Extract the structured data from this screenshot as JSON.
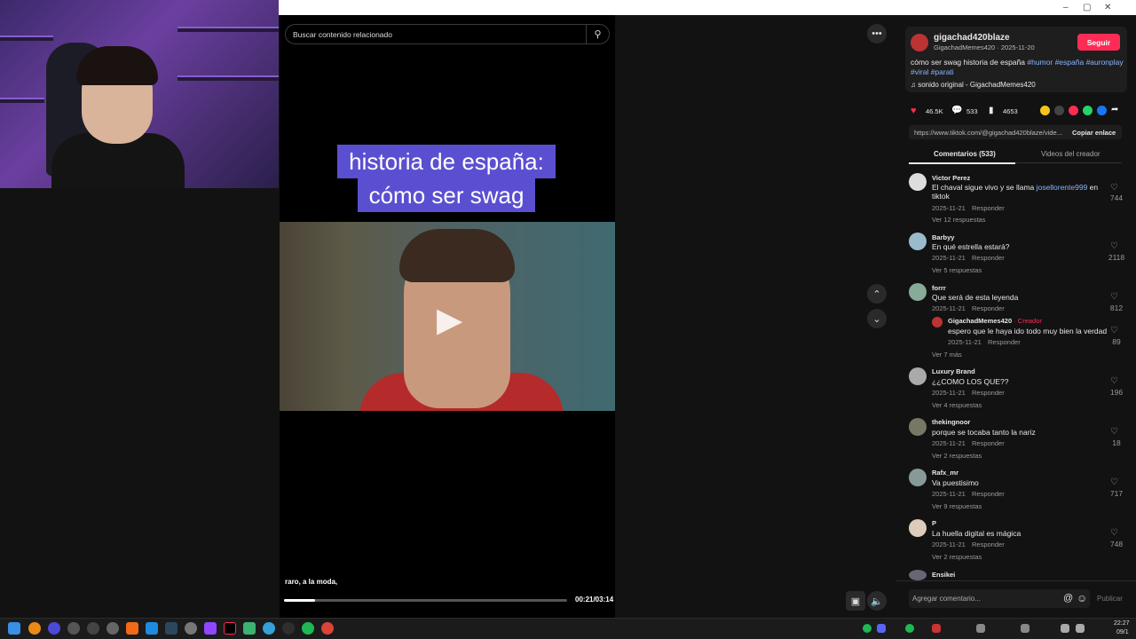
{
  "window_controls": {
    "minimize": "–",
    "maximize": "▢",
    "close": "✕"
  },
  "search": {
    "placeholder": "Buscar contenido relacionado"
  },
  "video": {
    "caption_line1": "historia de españa:",
    "caption_line2": "cómo ser swag",
    "subtitle": "raro, a la moda,",
    "time": "00:21/03:14",
    "progress_fraction": 0.11
  },
  "author": {
    "username": "gigachad420blaze",
    "display_and_date": "GigachadMemes420 · 2025-11-20",
    "follow_label": "Seguir",
    "description_text": "cómo ser swag historia de españa ",
    "hashtags": [
      "#humor",
      "#españa",
      "#auronplay",
      "#viral",
      "#parati"
    ],
    "sound": "sonido original - GigachadMemes420"
  },
  "stats": {
    "likes": "46.5K",
    "comments": "533",
    "saves": "4653"
  },
  "link": {
    "url": "https://www.tiktok.com/@gigachad420blaze/vide...",
    "copy_label": "Copiar enlace"
  },
  "tabs": {
    "comments": "Comentarios (533)",
    "creator_videos": "Videos del creador"
  },
  "comments": [
    {
      "name": "Victor Perez",
      "text_a": "El chaval sigue vivo y se llama ",
      "mention": "josellorente999",
      "text_b": " en",
      "text_c": "tiktok",
      "date": "2025-11-21",
      "reply": "Responder",
      "likes": "744",
      "more": "Ver 12 respuestas"
    },
    {
      "name": "Barbyy",
      "text": "En qué estrella estará?",
      "date": "2025-11-21",
      "reply": "Responder",
      "likes": "2118",
      "more": "Ver 5 respuestas"
    },
    {
      "name": "forrr",
      "text": "Que será de esta leyenda",
      "date": "2025-11-21",
      "reply": "Responder",
      "likes": "812",
      "sub": {
        "name": "GigachadMemes420",
        "badge": "· Creador",
        "text": "espero que le haya ido todo muy bien la verdad",
        "date": "2025-11-21",
        "reply": "Responder",
        "likes": "89"
      },
      "more": "Ver 7 más"
    },
    {
      "name": "Luxury Brand",
      "text": "¿¿COMO LOS QUE??",
      "date": "2025-11-21",
      "reply": "Responder",
      "likes": "196",
      "more": "Ver 4 respuestas"
    },
    {
      "name": "thekingnoor",
      "text": "porque se tocaba tanto la nariz",
      "date": "2025-11-21",
      "reply": "Responder",
      "likes": "18",
      "more": "Ver 2 respuestas"
    },
    {
      "name": "Rafx_mr",
      "text": "Va puestisimo",
      "date": "2025-11-21",
      "reply": "Responder",
      "likes": "717",
      "more": "Ver 9 respuestas"
    },
    {
      "name": "P",
      "text": "La huella digital es mágica",
      "date": "2025-11-21",
      "reply": "Responder",
      "likes": "748",
      "more": "Ver 2 respuestas"
    },
    {
      "name": "Ensikei"
    }
  ],
  "comment_input": {
    "placeholder": "Agregar comentario...",
    "post_label": "Publicar"
  },
  "taskbar": {
    "time": "22:27",
    "date": "09/1"
  },
  "colors": {
    "accent": "#fe2c55",
    "caption_bg": "#5b4fd1",
    "link": "#8ab4ff"
  }
}
